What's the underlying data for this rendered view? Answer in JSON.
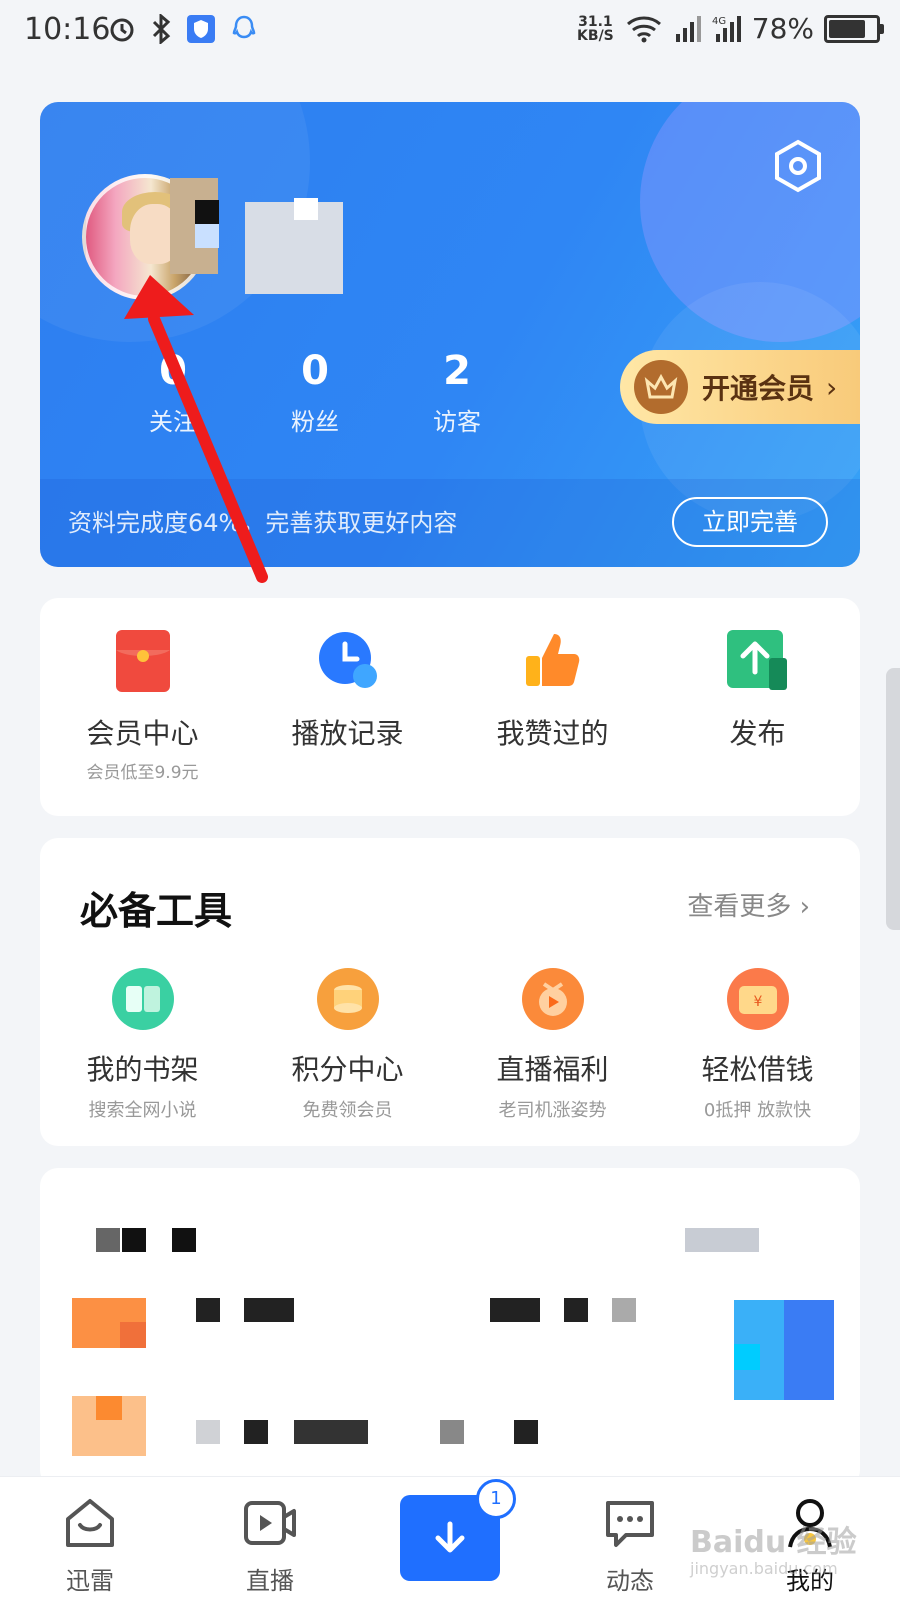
{
  "status_bar": {
    "time": "10:16",
    "speed_value": "31.1",
    "speed_unit": "KB/S",
    "network": "4G",
    "battery": "78%",
    "battery_level": 0.78
  },
  "profile": {
    "stats": [
      {
        "value": "0",
        "label": "关注"
      },
      {
        "value": "0",
        "label": "粉丝"
      },
      {
        "value": "2",
        "label": "访客"
      }
    ],
    "vip_button": "开通会员",
    "completion_text": "资料完成度64%，完善获取更好内容",
    "complete_button": "立即完善"
  },
  "quick_actions": [
    {
      "label": "会员中心",
      "sub": "会员低至9.9元",
      "icon": "red-envelope-icon"
    },
    {
      "label": "播放记录",
      "sub": "",
      "icon": "clock-icon"
    },
    {
      "label": "我赞过的",
      "sub": "",
      "icon": "thumbs-up-icon"
    },
    {
      "label": "发布",
      "sub": "",
      "icon": "upload-icon"
    }
  ],
  "tools": {
    "title": "必备工具",
    "more": "查看更多 ›",
    "items": [
      {
        "label": "我的书架",
        "sub": "搜索全网小说",
        "icon": "bookshelf-icon",
        "color": "#3ad0a2"
      },
      {
        "label": "积分中心",
        "sub": "免费领会员",
        "icon": "coins-icon",
        "color": "#f7a03d"
      },
      {
        "label": "直播福利",
        "sub": "老司机涨姿势",
        "icon": "live-gift-icon",
        "color": "#fb8a3a"
      },
      {
        "label": "轻松借钱",
        "sub": "0抵押 放款快",
        "icon": "money-bag-icon",
        "color": "#fb7a4a"
      }
    ]
  },
  "bottom_nav": {
    "items": [
      {
        "label": "迅雷"
      },
      {
        "label": "直播"
      },
      {
        "label": "动态"
      },
      {
        "label": "我的"
      }
    ],
    "download_badge": "1"
  },
  "watermark": {
    "main": "Baidu 经验",
    "sub": "jingyan.baidu.com"
  },
  "colors": {
    "primary": "#2f86f4",
    "vip_gold": "#f8c978",
    "download_blue": "#1f6fff",
    "annotation_red": "#ee1c1c"
  }
}
